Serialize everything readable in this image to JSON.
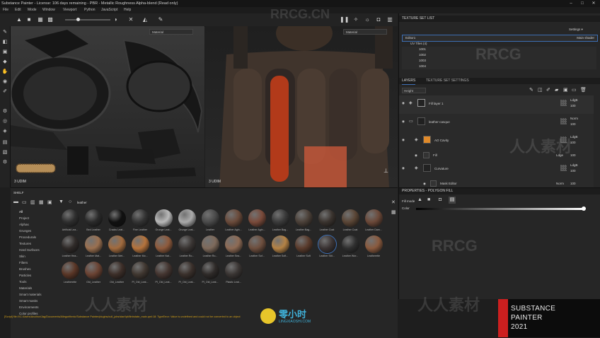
{
  "title_bar": {
    "text": "Substance Painter - License: 106 days remaining - PBR - Metallic Roughness Alpha-blend (Read only)",
    "min": "–",
    "max": "□",
    "close": "✕"
  },
  "menu": [
    "File",
    "Edit",
    "Mode",
    "Window",
    "Viewport",
    "Python",
    "JavaScript",
    "Help"
  ],
  "viewport_left": {
    "dropdown": "Material",
    "footer": "3 UDIM"
  },
  "viewport_right": {
    "dropdown": "Material",
    "footer": "3 UDIM"
  },
  "texture_set_list": {
    "header": "TEXTURE SET LIST",
    "settings_label": "Settings ▾",
    "main_item": "Editor1",
    "main_shader": "Main shader",
    "uv_tiles_label": "UV Tiles (4)",
    "tiles": [
      "1001",
      "1002",
      "1003",
      "1004"
    ]
  },
  "layers": {
    "tabs": [
      "LAYERS",
      "TEXTURE SET SETTINGS"
    ],
    "channel_dropdown": "Height",
    "rows": [
      {
        "name": "Fill layer 1",
        "blend": "LdgB",
        "opacity": "100"
      },
      {
        "name": "leather-casque",
        "blend": "Norm",
        "opacity": "100"
      },
      {
        "name": "AO Cavity",
        "blend": "LdgB",
        "opacity": "100"
      },
      {
        "name": "Fill",
        "blend": "Ldge",
        "opacity": "100"
      },
      {
        "name": "Curvature",
        "blend": "LdgB",
        "opacity": "100"
      },
      {
        "name": "Mask Editor",
        "blend": "Norm",
        "opacity": "100"
      }
    ]
  },
  "properties": {
    "header": "PROPERTIES - POLYGON FILL",
    "fill_mode_label": "Fill mode",
    "color_label": "Color"
  },
  "shelf": {
    "header": "SHELF",
    "search": "leather",
    "categories": [
      "All",
      "Project",
      "Alphas",
      "Grunges",
      "Procedurals",
      "Textures",
      "Hard Surfaces",
      "Skin",
      "Filters",
      "Brushes",
      "Particles",
      "Tools",
      "Materials",
      "Smart materials",
      "Smart masks",
      "Environments",
      "Color profiles"
    ],
    "materials": [
      "Artificial Lea...",
      "Bed Leather",
      "Cracks Leat...",
      "Fine Leather",
      "Grunge Leat...",
      "Grunge Leat...",
      "Leather",
      "Leather Agin...",
      "Leather Agin...",
      "Leather Bag...",
      "Leather Bag...",
      "Leather Coat",
      "Leather Coat",
      "Leather Dam...",
      "Leather Hea...",
      "Leather Mat...",
      "Leather Met...",
      "Leather Mo...",
      "Leather Nat...",
      "Leather Ro...",
      "Leather Ro...",
      "Leather Sea...",
      "Leather Sof...",
      "Leather Soft...",
      "Leather Soft",
      "Leather Stit...",
      "Leather Wor...",
      "Leatherette",
      "Leatherette",
      "Old_Leather",
      "Old_Leather",
      "PI_Old_Leat...",
      "PI_Old_Leat...",
      "PI_Old_Leat...",
      "PI_Old_Leat...",
      "Plastic Leat..."
    ]
  },
  "status": "[Script] file:///C:/Users/Anuthor/Jag/Documents/Allegorithmic/Substance Painter/plugins/cull_jobs/start/pkflintrotate_main.qml:18: TypeError: Value is undefined and could not be converted to an object",
  "branding": {
    "line1": "SUBSTANCE",
    "line2": "PAINTER",
    "line3": "2021"
  },
  "watermarks": {
    "rrcg": "RRCG",
    "rrcg_cn": "RRCG.CN",
    "cn_mark": "人人素材",
    "site_logo": "零小时",
    "site_url": "LINGXIAOSHI.COM"
  }
}
